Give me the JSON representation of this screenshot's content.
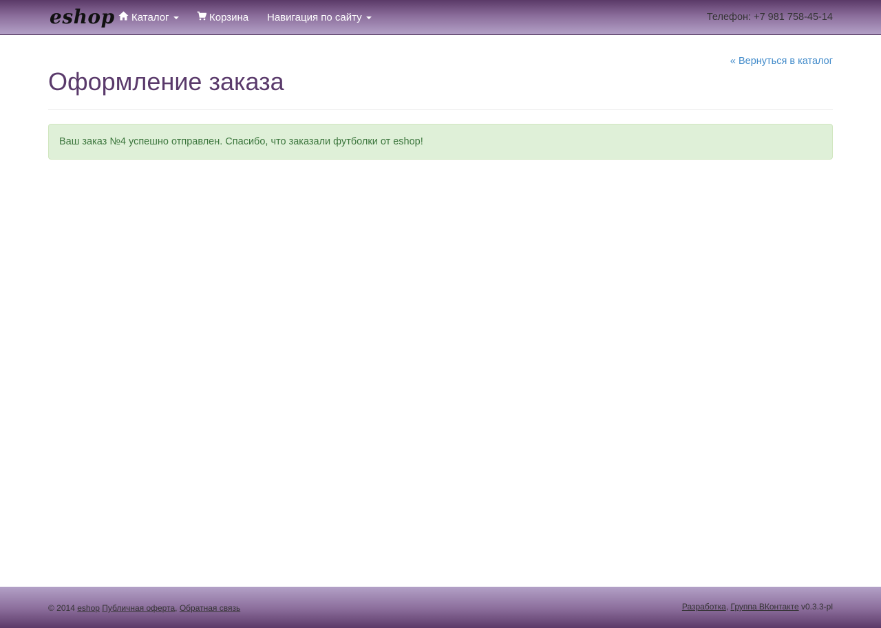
{
  "navbar": {
    "brand": "eshop",
    "catalog_label": "Каталог",
    "cart_label": "Корзина",
    "site_nav_label": "Навигация по сайту",
    "phone": "Телефон: +7 981 758-45-14"
  },
  "main": {
    "back_link": "« Вернуться в каталог",
    "title": "Оформление заказа",
    "alert_text": "Ваш заказ №4 успешно отправлен. Спасибо, что заказали футболки от eshop!"
  },
  "footer": {
    "copyright": "© 2014",
    "brand_link": "eshop",
    "offer_link": "Публичная оферта",
    "feedback_link": "Обратная связь",
    "dev_link": "Разработка",
    "vk_link": "Группа ВКонтакте",
    "version": "v0.3.3-pl",
    "separator": ","
  },
  "icons": {
    "catalog": "home-icon",
    "cart": "cart-icon",
    "dropdown": "caret-down-icon"
  },
  "colors": {
    "navbar_dark": "#5b3a68",
    "navbar_light": "#b3a1c7",
    "title": "#5a3a6b",
    "link": "#428bca",
    "alert_bg": "#dff0d8",
    "alert_text": "#3c763d"
  }
}
